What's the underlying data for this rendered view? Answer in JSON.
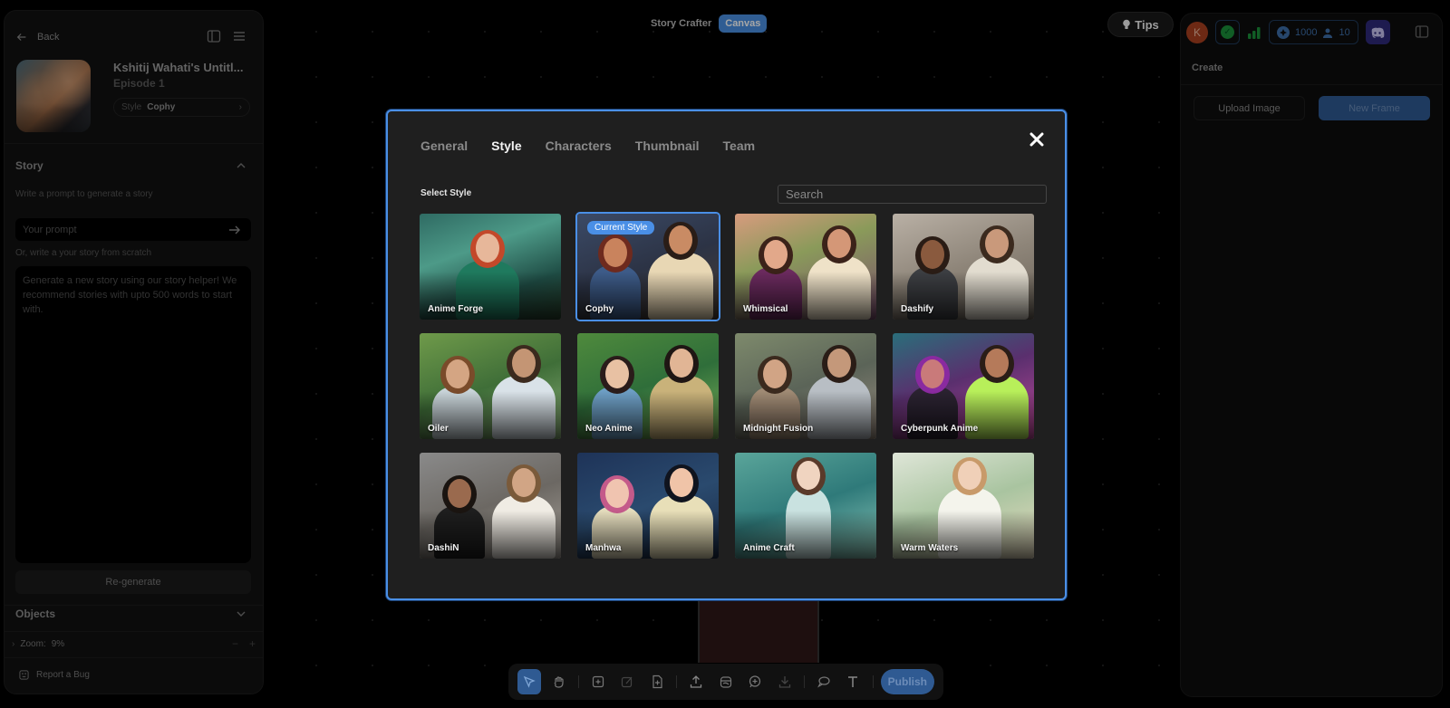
{
  "topbar": {
    "app_title": "Story Crafter",
    "mode_badge": "Canvas",
    "tips_label": "Tips"
  },
  "left_panel": {
    "back_label": "Back",
    "project_title": "Kshitij Wahati's Untitl...",
    "episode": "Episode 1",
    "style_key": "Style",
    "style_value": "Cophy",
    "story": {
      "title": "Story",
      "prompt_hint": "Write a prompt to generate a story",
      "prompt_placeholder": "Your prompt",
      "scratch_hint": "Or, write a your story from scratch",
      "story_placeholder": "Generate a new story using our story helper! We recommend stories with upto 500 words to start with.",
      "regenerate_label": "Re-generate"
    },
    "objects_title": "Objects",
    "zoom_label": "Zoom:",
    "zoom_value": "9%",
    "report_bug_label": "Report a Bug"
  },
  "right_panel": {
    "avatar_initial": "K",
    "credits": "1000",
    "members": "10",
    "create_title": "Create",
    "upload_label": "Upload Image",
    "new_frame_label": "New Frame"
  },
  "toolbar": {
    "publish_label": "Publish"
  },
  "modal": {
    "tabs": [
      {
        "label": "General",
        "active": false
      },
      {
        "label": "Style",
        "active": true
      },
      {
        "label": "Characters",
        "active": false
      },
      {
        "label": "Thumbnail",
        "active": false
      },
      {
        "label": "Team",
        "active": false
      }
    ],
    "select_label": "Select Style",
    "search_placeholder": "Search",
    "current_badge": "Current Style",
    "styles": [
      {
        "name": "Anime Forge",
        "current": false
      },
      {
        "name": "Cophy",
        "current": true
      },
      {
        "name": "Whimsical",
        "current": false
      },
      {
        "name": "Dashify",
        "current": false
      },
      {
        "name": "Oiler",
        "current": false
      },
      {
        "name": "Neo Anime",
        "current": false
      },
      {
        "name": "Midnight Fusion",
        "current": false
      },
      {
        "name": "Cyberpunk Anime",
        "current": false
      },
      {
        "name": "DashiN",
        "current": false
      },
      {
        "name": "Manhwa",
        "current": false
      },
      {
        "name": "Anime Craft",
        "current": false
      },
      {
        "name": "Warm Waters",
        "current": false
      }
    ]
  },
  "colors": {
    "accent": "#4a8fe6",
    "canvas_badge": "#4a90e2",
    "publish": "#2f5a92",
    "avatar": "#a8401f",
    "discord": "#2e2a7a",
    "ok": "#1b8f3a"
  }
}
